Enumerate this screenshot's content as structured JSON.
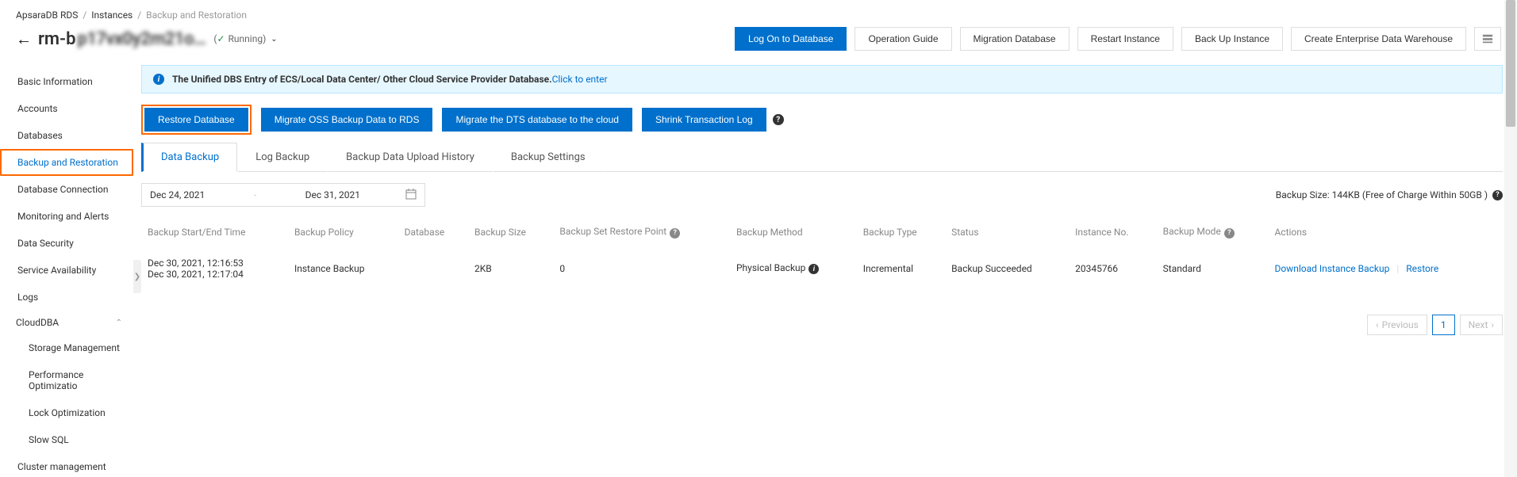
{
  "breadcrumb": {
    "root": "ApsaraDB RDS",
    "instances": "Instances",
    "current": "Backup and Restoration"
  },
  "header": {
    "instance_prefix": "rm-b",
    "instance_name": "p17vx0y2m21o…",
    "running_prefix": "( ",
    "running_label": "Running",
    "running_suffix": " )",
    "buttons": {
      "logon": "Log On to Database",
      "guide": "Operation Guide",
      "migration": "Migration Database",
      "restart": "Restart Instance",
      "backup": "Back Up Instance",
      "warehouse": "Create Enterprise Data Warehouse"
    }
  },
  "sidebar": {
    "basic": "Basic Information",
    "accounts": "Accounts",
    "databases": "Databases",
    "backup": "Backup and Restoration",
    "connection": "Database Connection",
    "monitoring": "Monitoring and Alerts",
    "security": "Data Security",
    "availability": "Service Availability",
    "logs": "Logs",
    "clouddba": "CloudDBA",
    "storage": "Storage Management",
    "perf": "Performance Optimizatio",
    "lock": "Lock Optimization",
    "slow": "Slow SQL",
    "cluster": "Cluster management"
  },
  "banner": {
    "text": "The Unified DBS Entry of ECS/Local Data Center/ Other Cloud Service Provider Database.",
    "link": "Click to enter"
  },
  "actions": {
    "restore": "Restore Database",
    "migrate_oss": "Migrate OSS Backup Data to RDS",
    "migrate_dts": "Migrate the DTS database to the cloud",
    "shrink": "Shrink Transaction Log"
  },
  "tabs": {
    "data": "Data Backup",
    "log": "Log Backup",
    "history": "Backup Data Upload History",
    "settings": "Backup Settings"
  },
  "filter": {
    "from": "Dec 24, 2021",
    "to": "Dec 31, 2021",
    "sep": "-",
    "size_label": "Backup Size: 144KB (Free of Charge Within 50GB )"
  },
  "table": {
    "cols": {
      "start": "Backup Start/End Time",
      "policy": "Backup Policy",
      "db": "Database",
      "size": "Backup Size",
      "point": "Backup Set Restore Point",
      "method": "Backup Method",
      "type": "Backup Type",
      "status": "Status",
      "instno": "Instance No.",
      "mode": "Backup Mode",
      "actions": "Actions"
    },
    "rows": [
      {
        "start1": "Dec 30, 2021, 12:16:53",
        "start2": "Dec 30, 2021, 12:17:04",
        "policy": "Instance Backup",
        "db": "",
        "size": "2KB",
        "point": "0",
        "method": "Physical Backup",
        "type": "Incremental",
        "status": "Backup Succeeded",
        "instno": "20345766",
        "mode": "Standard",
        "action_download": "Download Instance Backup",
        "action_restore": "Restore"
      }
    ]
  },
  "pager": {
    "prev": "Previous",
    "page": "1",
    "next": "Next"
  }
}
